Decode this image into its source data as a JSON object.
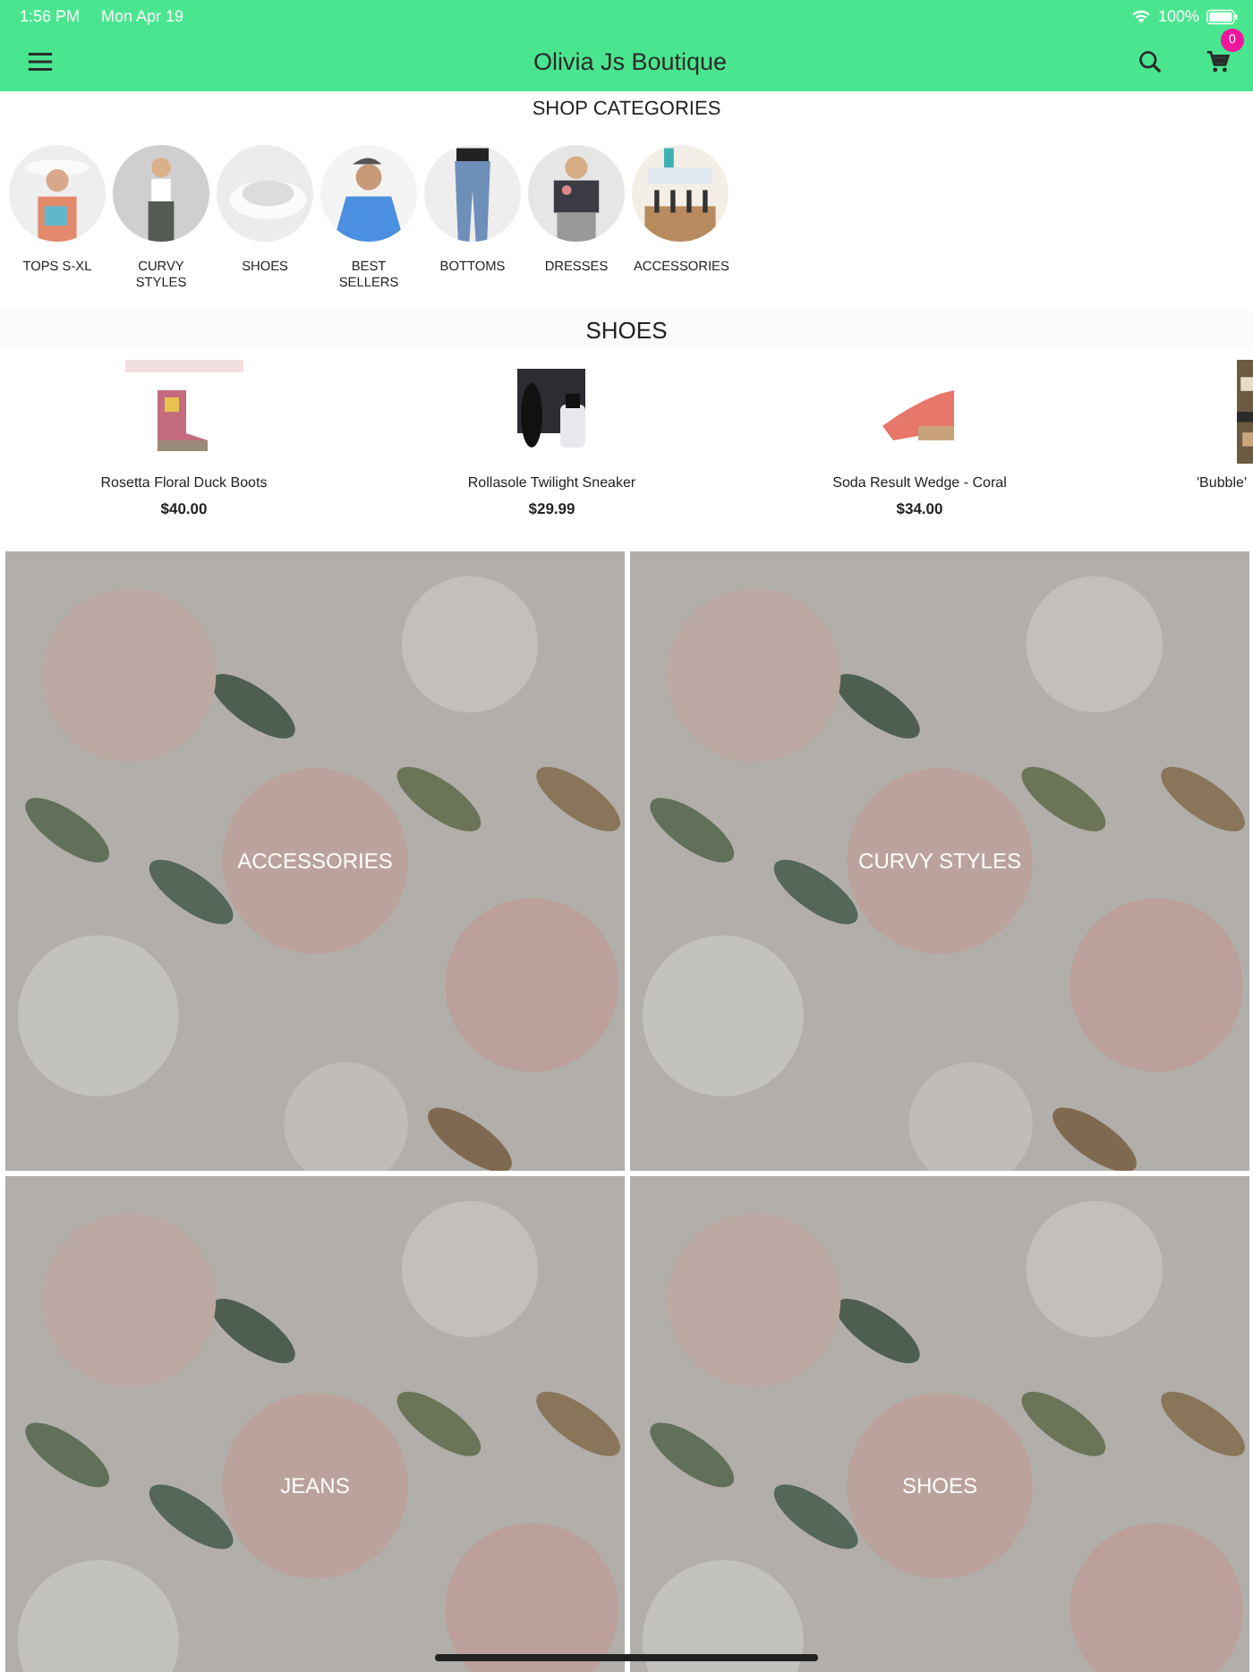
{
  "status_bar": {
    "time": "1:56 PM",
    "date": "Mon Apr 19",
    "battery": "100%"
  },
  "header": {
    "title": "Olivia Js Boutique",
    "cart_count": "0"
  },
  "categories": {
    "title": "SHOP CATEGORIES",
    "items": [
      {
        "label": "TOPS S-XL"
      },
      {
        "label": "CURVY STYLES"
      },
      {
        "label": "SHOES"
      },
      {
        "label": "BEST SELLERS"
      },
      {
        "label": "BOTTOMS"
      },
      {
        "label": "DRESSES"
      },
      {
        "label": "ACCESSORIES"
      }
    ]
  },
  "featured": {
    "title": "SHOES",
    "products": [
      {
        "name": "Rosetta Floral Duck Boots",
        "price": "$40.00"
      },
      {
        "name": "Rollasole Twilight Sneaker",
        "price": "$29.99"
      },
      {
        "name": "Soda Result Wedge - Coral",
        "price": "$34.00"
      },
      {
        "name": "'Bubble'"
      }
    ]
  },
  "tiles": [
    {
      "label": "ACCESSORIES"
    },
    {
      "label": "CURVY STYLES"
    },
    {
      "label": "JEANS"
    },
    {
      "label": "SHOES"
    }
  ]
}
